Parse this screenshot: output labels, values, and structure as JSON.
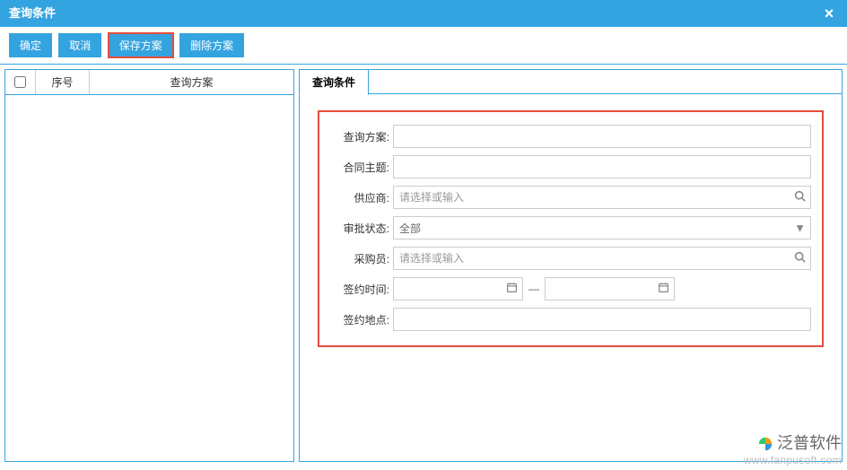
{
  "titlebar": {
    "title": "查询条件"
  },
  "toolbar": {
    "confirm": "确定",
    "cancel": "取消",
    "save_plan": "保存方案",
    "delete_plan": "删除方案"
  },
  "left": {
    "col_seq": "序号",
    "col_name": "查询方案"
  },
  "right": {
    "tab": "查询条件",
    "labels": {
      "plan": "查询方案:",
      "subject": "合同主题:",
      "supplier": "供应商:",
      "approval": "审批状态:",
      "buyer": "采购员:",
      "sign_time": "签约时间:",
      "sign_place": "签约地点:"
    },
    "values": {
      "plan": "",
      "subject": "",
      "supplier": "",
      "approval": "全部",
      "buyer": "",
      "sign_from": "",
      "sign_to": "",
      "sign_place": ""
    },
    "placeholders": {
      "supplier": "请选择或输入",
      "buyer": "请选择或输入"
    },
    "date_sep": "—"
  },
  "watermark": {
    "brand": "泛普软件",
    "url": "www.fanpusoft.com"
  }
}
